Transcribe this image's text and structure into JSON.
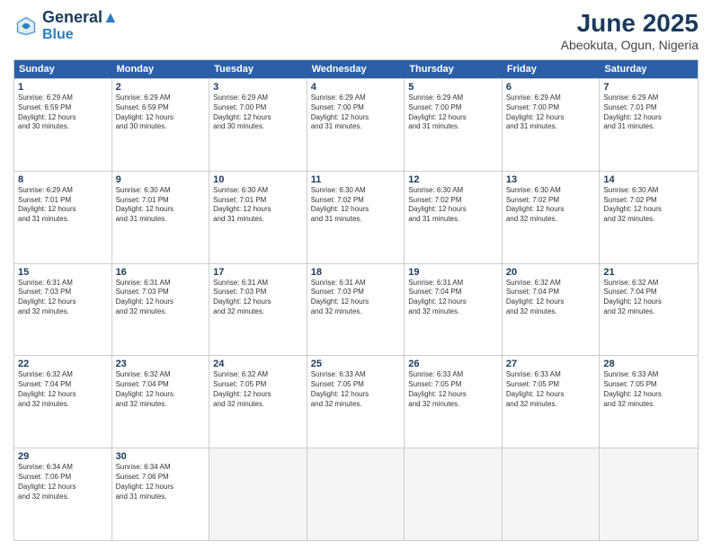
{
  "header": {
    "logo_line1": "General",
    "logo_line2": "Blue",
    "month": "June 2025",
    "location": "Abeokuta, Ogun, Nigeria"
  },
  "days_of_week": [
    "Sunday",
    "Monday",
    "Tuesday",
    "Wednesday",
    "Thursday",
    "Friday",
    "Saturday"
  ],
  "weeks": [
    [
      {
        "day": 1,
        "sunrise": "6:29 AM",
        "sunset": "6:59 PM",
        "daylight": "12 hours and 30 minutes."
      },
      {
        "day": 2,
        "sunrise": "6:29 AM",
        "sunset": "6:59 PM",
        "daylight": "12 hours and 30 minutes."
      },
      {
        "day": 3,
        "sunrise": "6:29 AM",
        "sunset": "7:00 PM",
        "daylight": "12 hours and 30 minutes."
      },
      {
        "day": 4,
        "sunrise": "6:29 AM",
        "sunset": "7:00 PM",
        "daylight": "12 hours and 31 minutes."
      },
      {
        "day": 5,
        "sunrise": "6:29 AM",
        "sunset": "7:00 PM",
        "daylight": "12 hours and 31 minutes."
      },
      {
        "day": 6,
        "sunrise": "6:29 AM",
        "sunset": "7:00 PM",
        "daylight": "12 hours and 31 minutes."
      },
      {
        "day": 7,
        "sunrise": "6:29 AM",
        "sunset": "7:01 PM",
        "daylight": "12 hours and 31 minutes."
      }
    ],
    [
      {
        "day": 8,
        "sunrise": "6:29 AM",
        "sunset": "7:01 PM",
        "daylight": "12 hours and 31 minutes."
      },
      {
        "day": 9,
        "sunrise": "6:30 AM",
        "sunset": "7:01 PM",
        "daylight": "12 hours and 31 minutes."
      },
      {
        "day": 10,
        "sunrise": "6:30 AM",
        "sunset": "7:01 PM",
        "daylight": "12 hours and 31 minutes."
      },
      {
        "day": 11,
        "sunrise": "6:30 AM",
        "sunset": "7:02 PM",
        "daylight": "12 hours and 31 minutes."
      },
      {
        "day": 12,
        "sunrise": "6:30 AM",
        "sunset": "7:02 PM",
        "daylight": "12 hours and 31 minutes."
      },
      {
        "day": 13,
        "sunrise": "6:30 AM",
        "sunset": "7:02 PM",
        "daylight": "12 hours and 32 minutes."
      },
      {
        "day": 14,
        "sunrise": "6:30 AM",
        "sunset": "7:02 PM",
        "daylight": "12 hours and 32 minutes."
      }
    ],
    [
      {
        "day": 15,
        "sunrise": "6:31 AM",
        "sunset": "7:03 PM",
        "daylight": "12 hours and 32 minutes."
      },
      {
        "day": 16,
        "sunrise": "6:31 AM",
        "sunset": "7:03 PM",
        "daylight": "12 hours and 32 minutes."
      },
      {
        "day": 17,
        "sunrise": "6:31 AM",
        "sunset": "7:03 PM",
        "daylight": "12 hours and 32 minutes."
      },
      {
        "day": 18,
        "sunrise": "6:31 AM",
        "sunset": "7:03 PM",
        "daylight": "12 hours and 32 minutes."
      },
      {
        "day": 19,
        "sunrise": "6:31 AM",
        "sunset": "7:04 PM",
        "daylight": "12 hours and 32 minutes."
      },
      {
        "day": 20,
        "sunrise": "6:32 AM",
        "sunset": "7:04 PM",
        "daylight": "12 hours and 32 minutes."
      },
      {
        "day": 21,
        "sunrise": "6:32 AM",
        "sunset": "7:04 PM",
        "daylight": "12 hours and 32 minutes."
      }
    ],
    [
      {
        "day": 22,
        "sunrise": "6:32 AM",
        "sunset": "7:04 PM",
        "daylight": "12 hours and 32 minutes."
      },
      {
        "day": 23,
        "sunrise": "6:32 AM",
        "sunset": "7:04 PM",
        "daylight": "12 hours and 32 minutes."
      },
      {
        "day": 24,
        "sunrise": "6:32 AM",
        "sunset": "7:05 PM",
        "daylight": "12 hours and 32 minutes."
      },
      {
        "day": 25,
        "sunrise": "6:33 AM",
        "sunset": "7:05 PM",
        "daylight": "12 hours and 32 minutes."
      },
      {
        "day": 26,
        "sunrise": "6:33 AM",
        "sunset": "7:05 PM",
        "daylight": "12 hours and 32 minutes."
      },
      {
        "day": 27,
        "sunrise": "6:33 AM",
        "sunset": "7:05 PM",
        "daylight": "12 hours and 32 minutes."
      },
      {
        "day": 28,
        "sunrise": "6:33 AM",
        "sunset": "7:05 PM",
        "daylight": "12 hours and 32 minutes."
      }
    ],
    [
      {
        "day": 29,
        "sunrise": "6:34 AM",
        "sunset": "7:06 PM",
        "daylight": "12 hours and 32 minutes."
      },
      {
        "day": 30,
        "sunrise": "6:34 AM",
        "sunset": "7:06 PM",
        "daylight": "12 hours and 31 minutes."
      },
      null,
      null,
      null,
      null,
      null
    ]
  ]
}
